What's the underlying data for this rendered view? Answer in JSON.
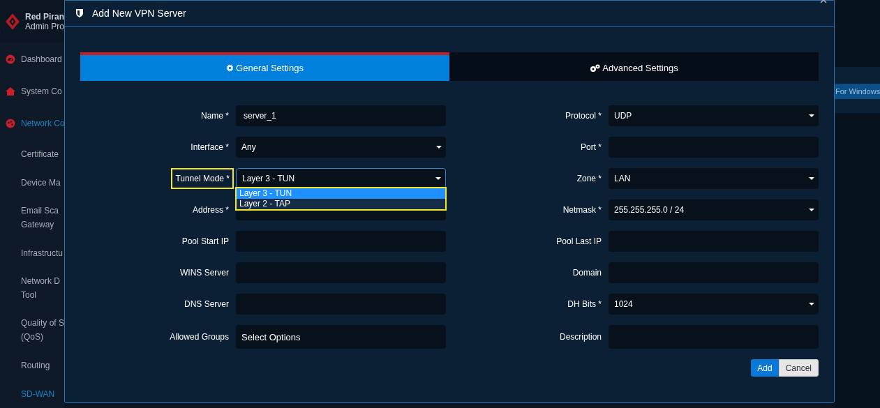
{
  "sidebar": {
    "brand": [
      "Red Piran",
      "Admin Pro"
    ],
    "items": [
      {
        "kind": "section",
        "lines": [
          "Dashboard"
        ],
        "selected": false
      },
      {
        "kind": "section",
        "lines": [
          "System Co"
        ],
        "selected": false
      },
      {
        "kind": "section",
        "lines": [
          "Network Co"
        ],
        "selected": true
      },
      {
        "kind": "sub",
        "lines": [
          "Certificate"
        ],
        "selected": false
      },
      {
        "kind": "sub",
        "lines": [
          "Device Ma"
        ],
        "selected": false
      },
      {
        "kind": "sub",
        "lines": [
          "Email Sca",
          "Gateway"
        ],
        "selected": false
      },
      {
        "kind": "sub",
        "lines": [
          "Infrastructu"
        ],
        "selected": false
      },
      {
        "kind": "sub",
        "lines": [
          "Network D",
          "Tool"
        ],
        "selected": false
      },
      {
        "kind": "sub",
        "lines": [
          "Quality of S",
          "(QoS)"
        ],
        "selected": false
      },
      {
        "kind": "sub",
        "lines": [
          "Routing"
        ],
        "selected": false
      },
      {
        "kind": "sub",
        "lines": [
          "SD-WAN"
        ],
        "selected": true
      }
    ]
  },
  "background_button": "For Windows",
  "dialog": {
    "title": "Add New VPN Server",
    "tabs": [
      {
        "label": "General Settings",
        "selected": true
      },
      {
        "label": "Advanced Settings",
        "selected": false
      }
    ],
    "left_fields": [
      {
        "label": "Name *",
        "kind": "text",
        "value": "server_1"
      },
      {
        "label": "Interface *",
        "kind": "select",
        "value": "Any"
      },
      {
        "label": "Tunnel Mode *",
        "kind": "select",
        "value": "Layer 3 - TUN",
        "highlighted": true,
        "expanded": true,
        "options": [
          {
            "label": "Layer 3 - TUN",
            "selected": true
          },
          {
            "label": "Layer 2 - TAP",
            "selected": false
          }
        ]
      },
      {
        "label": "Address *",
        "kind": "text"
      },
      {
        "label": "Pool Start IP",
        "kind": "text"
      },
      {
        "label": "WINS Server",
        "kind": "text"
      },
      {
        "label": "DNS Server",
        "kind": "text"
      },
      {
        "label": "Allowed Groups",
        "kind": "multi",
        "placeholder": "Select Options"
      }
    ],
    "right_fields": [
      {
        "label": "Protocol *",
        "kind": "select",
        "value": "UDP"
      },
      {
        "label": "Port *",
        "kind": "text"
      },
      {
        "label": "Zone *",
        "kind": "select",
        "value": "LAN"
      },
      {
        "label": "Netmask *",
        "kind": "select",
        "value": "255.255.255.0 / 24"
      },
      {
        "label": "Pool Last IP",
        "kind": "text"
      },
      {
        "label": "Domain",
        "kind": "text"
      },
      {
        "label": "DH Bits *",
        "kind": "select",
        "value": "1024"
      },
      {
        "label": "Description",
        "kind": "text"
      }
    ],
    "buttons": [
      {
        "label": "Add",
        "kind": "primary"
      },
      {
        "label": "Cancel",
        "kind": "secondary"
      }
    ]
  }
}
